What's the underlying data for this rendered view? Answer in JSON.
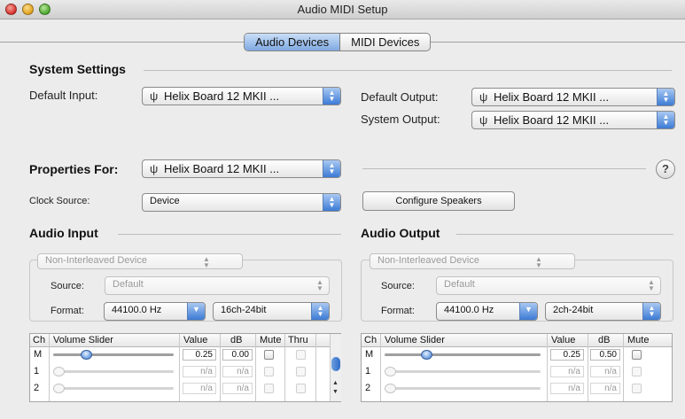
{
  "window": {
    "title": "Audio MIDI Setup"
  },
  "tabs": [
    {
      "label": "Audio Devices",
      "active": true
    },
    {
      "label": "MIDI Devices",
      "active": false
    }
  ],
  "system_settings": {
    "title": "System Settings",
    "default_input_label": "Default Input:",
    "default_input_value": "Helix Board 12 MKII ...",
    "default_output_label": "Default Output:",
    "default_output_value": "Helix Board 12 MKII ...",
    "system_output_label": "System Output:",
    "system_output_value": "Helix Board 12 MKII ..."
  },
  "properties": {
    "label": "Properties For:",
    "value": "Helix Board 12 MKII ...",
    "help": "?",
    "clock_source_label": "Clock Source:",
    "clock_source_value": "Device",
    "configure_speakers": "Configure Speakers"
  },
  "audio_input": {
    "title": "Audio Input",
    "mode": "Non-Interleaved Device",
    "source_label": "Source:",
    "source_value": "Default",
    "format_label": "Format:",
    "rate": "44100.0 Hz",
    "bits": "16ch-24bit",
    "columns": [
      "Ch",
      "Volume Slider",
      "Value",
      "dB",
      "Mute",
      "Thru"
    ],
    "rows": [
      {
        "ch": "M",
        "level": 0.25,
        "value": "0.25",
        "db": "0.00",
        "enabled": true
      },
      {
        "ch": "1",
        "level": 0.0,
        "value": "n/a",
        "db": "n/a",
        "enabled": false
      },
      {
        "ch": "2",
        "level": 0.0,
        "value": "n/a",
        "db": "n/a",
        "enabled": false
      }
    ]
  },
  "audio_output": {
    "title": "Audio Output",
    "mode": "Non-Interleaved Device",
    "source_label": "Source:",
    "source_value": "Default",
    "format_label": "Format:",
    "rate": "44100.0 Hz",
    "bits": "2ch-24bit",
    "columns": [
      "Ch",
      "Volume Slider",
      "Value",
      "dB",
      "Mute"
    ],
    "rows": [
      {
        "ch": "M",
        "level": 0.25,
        "value": "0.25",
        "db": "0.50",
        "enabled": true
      },
      {
        "ch": "1",
        "level": 0.0,
        "value": "n/a",
        "db": "n/a",
        "enabled": false
      },
      {
        "ch": "2",
        "level": 0.0,
        "value": "n/a",
        "db": "n/a",
        "enabled": false
      }
    ]
  },
  "icons": {
    "device": "device-icon",
    "popup_arrows": "updown-arrows-icon",
    "dropdown": "chevron-down-icon"
  }
}
